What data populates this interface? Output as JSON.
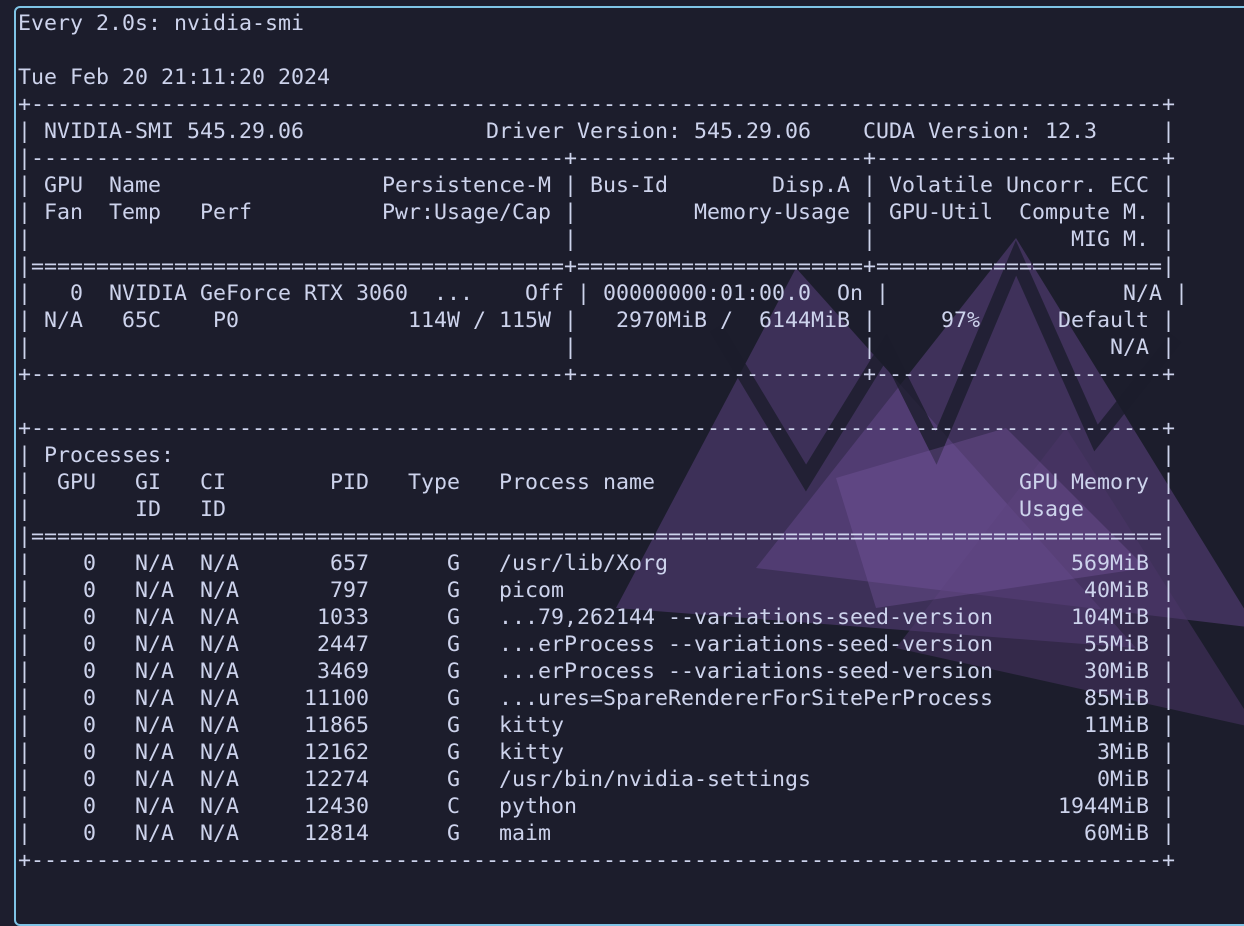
{
  "window": {
    "watch_header": "Every 2.0s: nvidia-smi",
    "timestamp": "Tue Feb 20 21:11:20 2024"
  },
  "gpu_table": {
    "smi_version_line": "| NVIDIA-SMI 545.29.06              Driver Version: 545.29.06    CUDA Version: 12.3     |",
    "header_row_1": "| GPU  Name                 Persistence-M | Bus-Id        Disp.A | Volatile Uncorr. ECC |",
    "header_row_2": "| Fan  Temp   Perf          Pwr:Usage/Cap |         Memory-Usage | GPU-Util  Compute M. |",
    "header_row_3": "|                                         |                      |               MIG M. |",
    "gpu_row_1": "|   0  NVIDIA GeForce RTX 3060  ...    Off | 00000000:01:00.0  On |                  N/A |",
    "gpu_row_2": "| N/A   65C    P0             114W / 115W |   2970MiB /  6144MiB |     97%      Default |",
    "gpu_row_3": "|                                         |                      |                  N/A |"
  },
  "process_table": {
    "title_line": "| Processes:                                                                            |",
    "header_row_1": "|  GPU   GI   CI        PID   Type   Process name                            GPU Memory |",
    "header_row_2": "|        ID   ID                                                             Usage      |",
    "rows": [
      "|    0   N/A  N/A       657      G   /usr/lib/Xorg                               569MiB |",
      "|    0   N/A  N/A       797      G   picom                                        40MiB |",
      "|    0   N/A  N/A      1033      G   ...79,262144 --variations-seed-version      104MiB |",
      "|    0   N/A  N/A      2447      G   ...erProcess --variations-seed-version       55MiB |",
      "|    0   N/A  N/A      3469      G   ...erProcess --variations-seed-version       30MiB |",
      "|    0   N/A  N/A     11100      G   ...ures=SpareRendererForSitePerProcess       85MiB |",
      "|    0   N/A  N/A     11865      G   kitty                                        11MiB |",
      "|    0   N/A  N/A     12162      G   kitty                                         3MiB |",
      "|    0   N/A  N/A     12274      G   /usr/bin/nvidia-settings                      0MiB |",
      "|    0   N/A  N/A     12430      C   python                                     1944MiB |",
      "|    0   N/A  N/A     12814      G   maim                                         60MiB |"
    ]
  },
  "borders": {
    "top": "+---------------------------------------------------------------------------------------+",
    "gpu_section_sep": "|-----------------------------------------+----------------------+----------------------+",
    "gpu_header_end": "|=========================================+======================+======================|",
    "gpu_bottom": "+-----------------------------------------+----------------------+----------------------+",
    "proc_top": "+---------------------------------------------------------------------------------------+",
    "proc_header_end": "|=======================================================================================|",
    "proc_bottom": "+---------------------------------------------------------------------------------------+"
  },
  "colors": {
    "terminal_bg": "#1c1d2c",
    "text": "#cdd3ec",
    "window_border": "#7fc4e6",
    "wallpaper_accent": "#5a3f7e"
  },
  "icons": {
    "wallpaper": "purple-triangle-wallpaper-icon"
  }
}
